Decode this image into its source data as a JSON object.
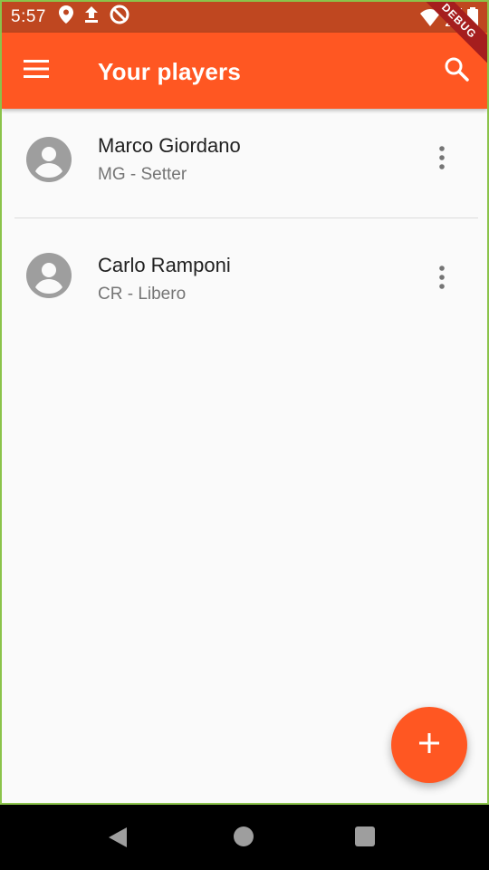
{
  "status_bar": {
    "time": "5:57",
    "icons_left": [
      "location-icon",
      "upload-icon",
      "no-entry-icon"
    ],
    "icons_right": [
      "wifi-icon",
      "signal-icon",
      "battery-icon"
    ]
  },
  "debug_banner": "DEBUG",
  "app_bar": {
    "title": "Your players",
    "menu_icon": "menu-icon",
    "search_icon": "search-icon",
    "background_color": "#ff5722"
  },
  "players": [
    {
      "name": "Marco Giordano",
      "subtitle": "MG - Setter"
    },
    {
      "name": "Carlo Ramponi",
      "subtitle": "CR - Libero"
    }
  ],
  "fab": {
    "icon": "plus-icon",
    "color": "#ff5722"
  },
  "nav_bar": {
    "back": "back-icon",
    "home": "home-icon",
    "recents": "recents-icon"
  }
}
